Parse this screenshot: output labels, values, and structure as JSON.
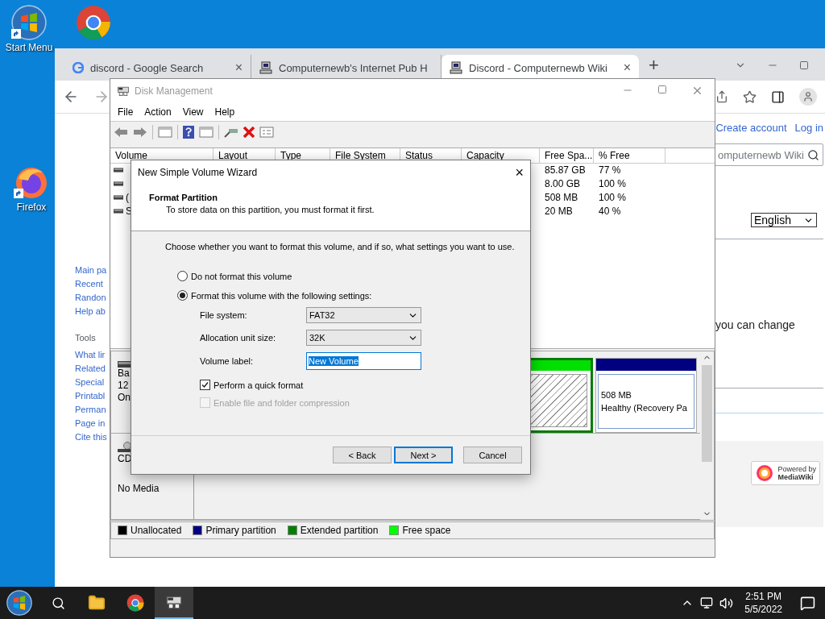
{
  "desktop_icons": [
    {
      "kind": "windows",
      "label": "Start Menu"
    },
    {
      "kind": "chrome"
    },
    {
      "kind": "firefox",
      "label": "Firefox"
    }
  ],
  "browser": {
    "tabs": [
      {
        "kind": "google",
        "title": "discord - Google Search",
        "close": "×",
        "selected": false
      },
      {
        "kind": "computer",
        "title": "Computernewb's Internet Pub H",
        "selected": false
      },
      {
        "kind": "computer",
        "title": "Discord - Computernewb Wiki",
        "close": "×",
        "selected": true
      }
    ],
    "new_tab": "+",
    "page": {
      "navigation": [
        "Main pa",
        "Recent",
        "Randon",
        "Help ab"
      ],
      "tools_heading": "Tools",
      "tools": [
        "What lir",
        "Related",
        "Special",
        "Printabl",
        "Perman",
        "Page in",
        "Cite this"
      ],
      "account_links": [
        "Create account",
        "Log in"
      ],
      "search": {
        "placeholder": "omputernewb Wiki"
      },
      "language": "English",
      "body_text": "you can change",
      "badge": {
        "line_1": "Powered by",
        "line_2": "MediaWiki"
      }
    }
  },
  "disk_management": {
    "title": "Disk Management",
    "menu": [
      "File",
      "Action",
      "View",
      "Help"
    ],
    "columns": [
      "Volume",
      "Layout",
      "Type",
      "File System",
      "Status",
      "Capacity",
      "Free Spa...",
      "% Free"
    ],
    "rows": [
      {
        "free_space": "85.87 GB",
        "percent_free": "77 %"
      },
      {
        "free_space": "8.00 GB",
        "percent_free": "100 %"
      },
      {
        "volume": "(",
        "free_space": "508 MB",
        "percent_free": "100 %"
      },
      {
        "volume": "S",
        "free_space": "20 MB",
        "percent_free": "40 %"
      }
    ],
    "disks": [
      {
        "kind": "basic",
        "label_lines": [
          "Ba",
          "12",
          "On"
        ],
        "partitions": [
          {
            "kind": "free"
          },
          {
            "kind": "primary",
            "size": "508 MB",
            "status": "Healthy (Recovery Pa"
          }
        ]
      },
      {
        "kind": "cdrom",
        "label_lines": [
          "CD"
        ],
        "media": "No Media"
      }
    ],
    "legend": [
      {
        "label": "Unallocated",
        "color": "#000000"
      },
      {
        "label": "Primary partition",
        "color": "#000080"
      },
      {
        "label": "Extended partition",
        "color": "#008000"
      },
      {
        "label": "Free space",
        "color": "#00ff00"
      }
    ]
  },
  "wizard": {
    "title": "New Simple Volume Wizard",
    "close": "×",
    "heading": "Format Partition",
    "subheading": "To store data on this partition, you must format it first.",
    "instruction": "Choose whether you want to format this volume, and if so, what settings you want to use.",
    "options": [
      {
        "label": "Do not format this volume",
        "selected": false
      },
      {
        "label": "Format this volume with the following settings:",
        "selected": true
      }
    ],
    "fields": [
      {
        "kind": "select",
        "label": "File system:",
        "value": "FAT32"
      },
      {
        "kind": "select",
        "label": "Allocation unit size:",
        "value": "32K"
      },
      {
        "kind": "text",
        "label": "Volume label:",
        "value": "New Volume",
        "highlighted": true
      }
    ],
    "checkboxes": [
      {
        "label": "Perform a quick format",
        "checked": true,
        "disabled": false
      },
      {
        "label": "Enable file and folder compression",
        "checked": false,
        "disabled": true
      }
    ],
    "buttons": [
      {
        "label": "< Back",
        "default": false
      },
      {
        "label": "Next >",
        "default": true
      },
      {
        "label": "Cancel",
        "default": false
      }
    ]
  },
  "taskbar": {
    "apps": [
      {
        "kind": "folder",
        "selected": false
      },
      {
        "kind": "chrome",
        "selected": false
      },
      {
        "kind": "disk",
        "selected": true
      }
    ],
    "time": "2:51 PM",
    "date": "5/5/2022"
  }
}
